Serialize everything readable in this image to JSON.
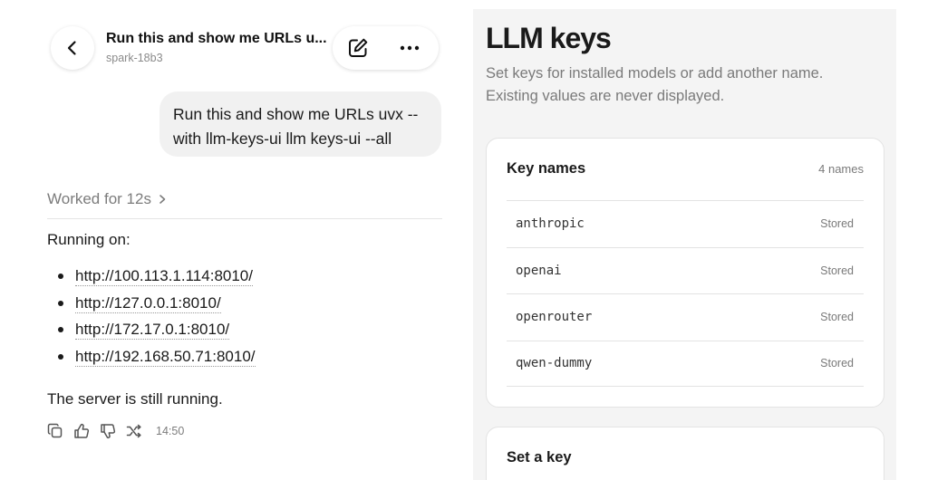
{
  "chat": {
    "title": "Run this and show me URLs u...",
    "subtitle": "spark-18b3",
    "user_message": "Run this and show me URLs uvx --with llm-keys-ui llm keys-ui --all",
    "worked": "Worked for 12s",
    "running_label": "Running on:",
    "urls": [
      "http://100.113.1.114:8010/",
      "http://127.0.0.1:8010/",
      "http://172.17.0.1:8010/",
      "http://192.168.50.71:8010/"
    ],
    "status": "The server is still running.",
    "time": "14:50",
    "icons": {
      "back": "chevron-left-icon",
      "edit": "edit-icon",
      "more": "more-horizontal-icon",
      "worked": "chevron-right-icon",
      "actions": [
        "copy-icon",
        "thumbs-up-icon",
        "thumbs-down-icon",
        "shuffle-icon"
      ]
    }
  },
  "keys": {
    "title": "LLM keys",
    "description": "Set keys for installed models or add another name. Existing values are never displayed.",
    "names_card": {
      "heading": "Key names",
      "count": "4 names",
      "rows": [
        {
          "name": "anthropic",
          "status": "Stored"
        },
        {
          "name": "openai",
          "status": "Stored"
        },
        {
          "name": "openrouter",
          "status": "Stored"
        },
        {
          "name": "qwen-dummy",
          "status": "Stored"
        }
      ]
    },
    "set_card": {
      "heading": "Set a key"
    }
  },
  "colors": {
    "bubble": "#f1f1f1",
    "pane_bg": "#f4f4f4",
    "muted_text": "#7a7a7a",
    "border": "#e3e3e3"
  }
}
